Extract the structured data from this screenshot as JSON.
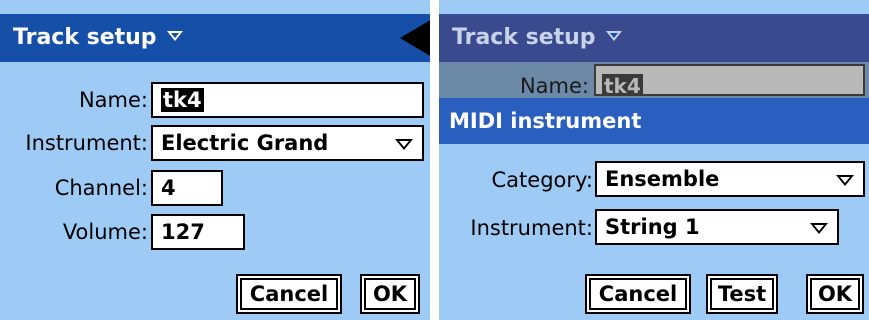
{
  "left": {
    "title": "Track setup",
    "labels": {
      "name": "Name:",
      "instrument": "Instrument:",
      "channel": "Channel:",
      "volume": "Volume:"
    },
    "values": {
      "name": "tk4",
      "instrument": "Electric Grand",
      "channel": "4",
      "volume": "127"
    },
    "buttons": {
      "cancel": "Cancel",
      "ok": "OK"
    }
  },
  "right": {
    "title": "Track setup",
    "background_name_label": "Name:",
    "background_name_value": "tk4",
    "dialog_title": "MIDI instrument",
    "labels": {
      "category": "Category:",
      "instrument": "Instrument:"
    },
    "values": {
      "category": "Ensemble",
      "instrument": "String 1"
    },
    "buttons": {
      "cancel": "Cancel",
      "test": "Test",
      "ok": "OK"
    }
  },
  "colors": {
    "titlebar": "#154fa7",
    "dialog_titlebar": "#2a5fc0",
    "background": "#9ecbf6",
    "field": "#ffffff"
  },
  "icons": {
    "title_menu": "triangle-down-icon",
    "dropdown": "dropdown-arrow-icon",
    "back": "back-triangle-icon"
  }
}
